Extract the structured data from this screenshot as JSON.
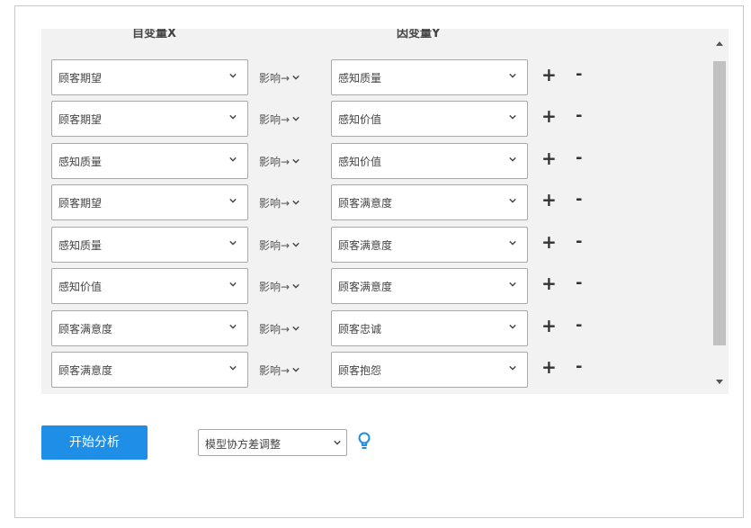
{
  "headers": {
    "x_label": "自变量X",
    "y_label": "因变量Y"
  },
  "rows": [
    {
      "x": "顾客期望",
      "rel": "影响→",
      "y": "感知质量"
    },
    {
      "x": "顾客期望",
      "rel": "影响→",
      "y": "感知价值"
    },
    {
      "x": "感知质量",
      "rel": "影响→",
      "y": "感知价值"
    },
    {
      "x": "顾客期望",
      "rel": "影响→",
      "y": "顾客满意度"
    },
    {
      "x": "感知质量",
      "rel": "影响→",
      "y": "顾客满意度"
    },
    {
      "x": "感知价值",
      "rel": "影响→",
      "y": "顾客满意度"
    },
    {
      "x": "顾客满意度",
      "rel": "影响→",
      "y": "顾客忠诚"
    },
    {
      "x": "顾客满意度",
      "rel": "影响→",
      "y": "顾客抱怨"
    }
  ],
  "controls": {
    "plus": "+",
    "minus": "-"
  },
  "footer": {
    "start_label": "开始分析",
    "model_option": "模型协方差调整"
  },
  "colors": {
    "accent": "#1e8ee6",
    "bulb": "#1e8ee6"
  }
}
